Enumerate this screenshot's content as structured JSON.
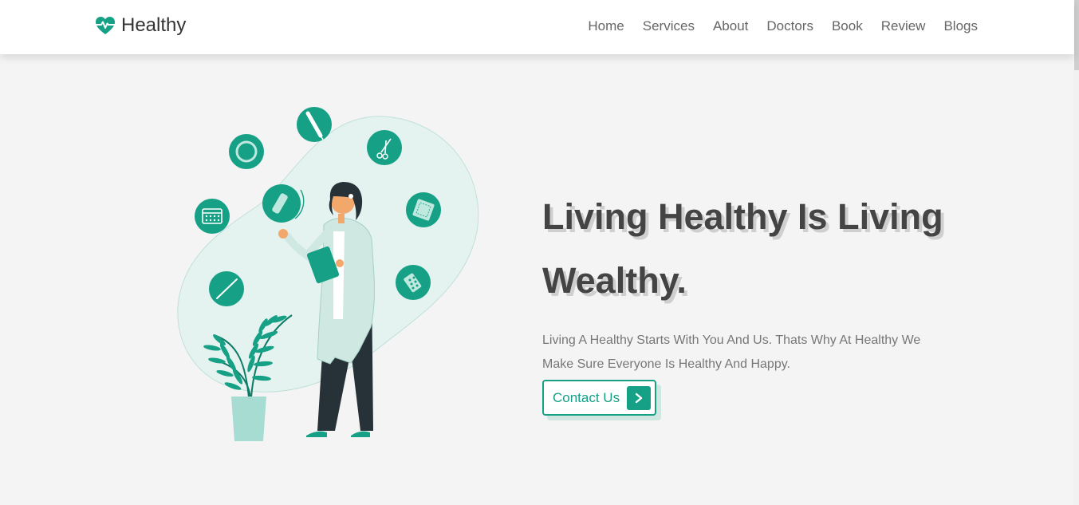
{
  "brand": {
    "name": "Healthy",
    "icon": "heartbeat-icon",
    "color": "#16a085"
  },
  "nav": {
    "items": [
      {
        "label": "Home"
      },
      {
        "label": "Services"
      },
      {
        "label": "About"
      },
      {
        "label": "Doctors"
      },
      {
        "label": "Book"
      },
      {
        "label": "Review"
      },
      {
        "label": "Blogs"
      }
    ]
  },
  "hero": {
    "title": "Living Healthy Is Living Wealthy.",
    "description": "Living A Healthy Starts With You And Us. Thats Why At Healthy We Make Sure Everyone Is Healthy And Happy.",
    "cta_label": "Contact Us",
    "cta_icon": "chevron-right-icon"
  },
  "colors": {
    "accent": "#16a085",
    "accent_light": "#cfe7e0",
    "background": "#f4f4f4",
    "heading": "#444444",
    "body_text": "#777777"
  }
}
